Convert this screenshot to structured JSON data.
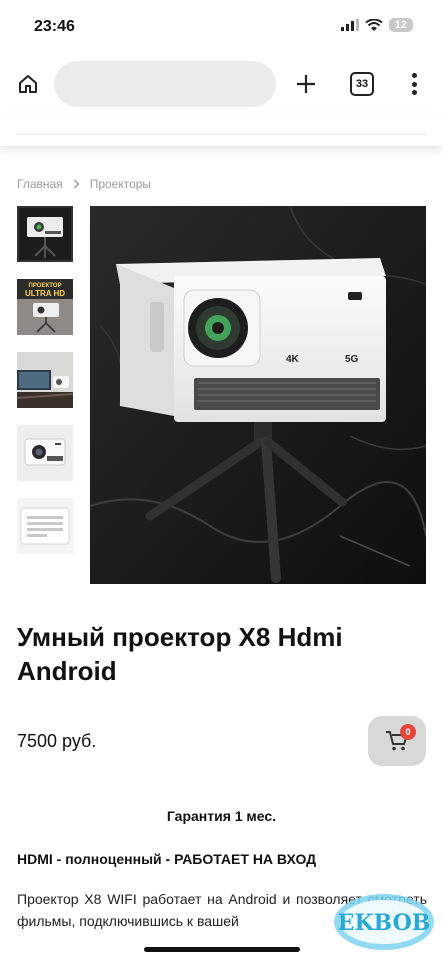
{
  "status": {
    "time": "23:46",
    "battery": "12"
  },
  "browser": {
    "url_placeholder": "",
    "tabs_count": "33"
  },
  "breadcrumb": {
    "items": [
      "Главная",
      "Проекторы"
    ]
  },
  "product": {
    "title": "Умный проектор X8 Hdmi Android",
    "price": "7500 руб.",
    "image_badge_4k": "4K",
    "image_badge_5g": "5G",
    "thumb2_text_top": "ПРОЕКТОР",
    "thumb2_text_bottom": "ULTRA HD"
  },
  "cart": {
    "count": "0"
  },
  "content": {
    "warranty": "Гарантия 1 мес.",
    "hdmi_line": "HDMI - полноценный - РАБОТАЕТ НА ВХОД",
    "description": "Проектор X8 WIFI работает на Android и позволяет смотреть фильмы, подключившись к вашей"
  },
  "watermark": {
    "text": "EKBOB"
  }
}
